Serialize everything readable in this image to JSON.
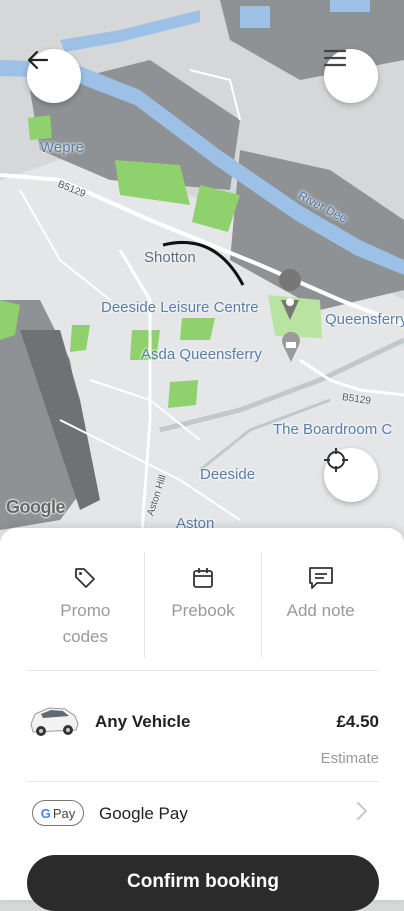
{
  "map": {
    "labels": {
      "wepre": "Wepre",
      "shotton": "Shotton",
      "leisure": "Deeside Leisure Centre",
      "queensferry": "Queensferry",
      "asda": "Asda Queensferry",
      "boardroom": "The Boardroom C",
      "deeside": "Deeside",
      "aston": "Aston",
      "river": "River Dee",
      "b5129_top": "B5129",
      "b5129_right": "B5129",
      "aston_hill": "Aston Hill"
    },
    "google_logo": "Google",
    "colors": {
      "land": "#d5d7d8",
      "urban": "#e6e8ea",
      "water": "#9cc0e6",
      "park": "#8fd16c",
      "dark": "#8e9294",
      "road": "#ffffff"
    }
  },
  "controls": {
    "back_icon": "arrow-left-icon",
    "menu_icon": "hamburger-menu-icon",
    "locate_icon": "crosshair-icon"
  },
  "quick_actions": [
    {
      "label": "Promo codes",
      "icon": "tag-icon"
    },
    {
      "label": "Prebook",
      "icon": "calendar-icon"
    },
    {
      "label": "Add note",
      "icon": "note-icon"
    }
  ],
  "vehicle": {
    "name": "Any Vehicle",
    "price": "£4.50",
    "estimate": "Estimate",
    "icon": "car-icon"
  },
  "payment": {
    "badge": "Pay",
    "method": "Google Pay",
    "icon": "chevron-right-icon"
  },
  "confirm_label": "Confirm booking"
}
